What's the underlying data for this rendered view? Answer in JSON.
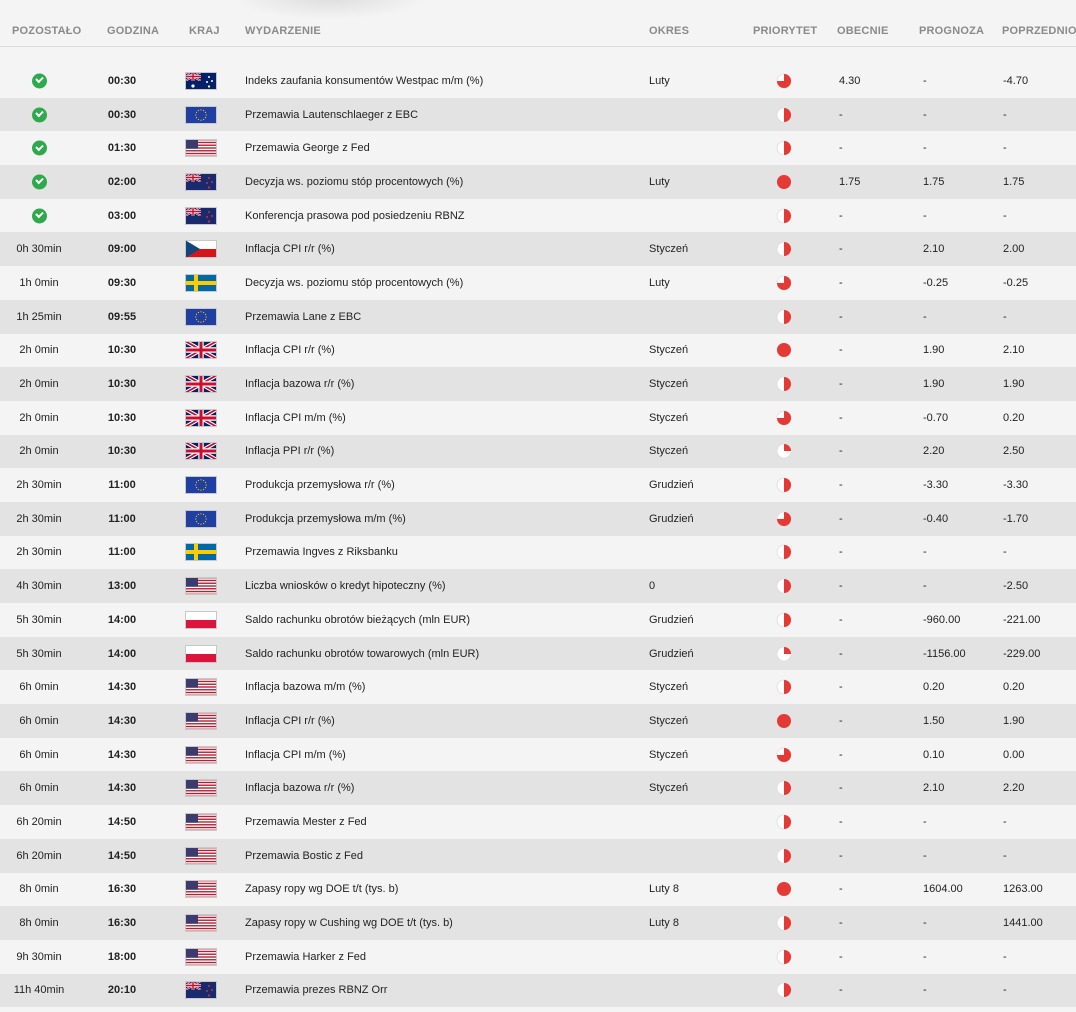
{
  "headers": {
    "remaining": "POZOSTAŁO",
    "time": "GODZINA",
    "country": "KRAJ",
    "event": "WYDARZENIE",
    "period": "OKRES",
    "priority": "PRIORYTET",
    "actual": "OBECNIE",
    "forecast": "PROGNOZA",
    "previous": "POPRZEDNIO"
  },
  "colors": {
    "check": "#2eaa4c",
    "priority": "#e53935"
  },
  "rows": [
    {
      "remaining": "",
      "done": true,
      "time": "00:30",
      "flag": "AU",
      "event": "Indeks zaufania konsumentów Westpac m/m (%)",
      "period": "Luty",
      "priority": 3,
      "actual": "4.30",
      "forecast": "-",
      "previous": "-4.70"
    },
    {
      "remaining": "",
      "done": true,
      "time": "00:30",
      "flag": "EU",
      "event": "Przemawia Lautenschlaeger z EBC",
      "period": "",
      "priority": 2,
      "actual": "-",
      "forecast": "-",
      "previous": "-"
    },
    {
      "remaining": "",
      "done": true,
      "time": "01:30",
      "flag": "US",
      "event": "Przemawia George z Fed",
      "period": "",
      "priority": 2,
      "actual": "-",
      "forecast": "-",
      "previous": "-"
    },
    {
      "remaining": "",
      "done": true,
      "time": "02:00",
      "flag": "NZ",
      "event": "Decyzja ws. poziomu stóp procentowych (%)",
      "period": "Luty",
      "priority": 4,
      "actual": "1.75",
      "forecast": "1.75",
      "previous": "1.75"
    },
    {
      "remaining": "",
      "done": true,
      "time": "03:00",
      "flag": "NZ",
      "event": "Konferencja prasowa pod posiedzeniu RBNZ",
      "period": "",
      "priority": 2,
      "actual": "-",
      "forecast": "-",
      "previous": "-"
    },
    {
      "remaining": "0h 30min",
      "done": false,
      "time": "09:00",
      "flag": "CZ",
      "event": "Inflacja CPI r/r (%)",
      "period": "Styczeń",
      "priority": 2,
      "actual": "-",
      "forecast": "2.10",
      "previous": "2.00"
    },
    {
      "remaining": "1h 0min",
      "done": false,
      "time": "09:30",
      "flag": "SE",
      "event": "Decyzja ws. poziomu stóp procentowych (%)",
      "period": "Luty",
      "priority": 3,
      "actual": "-",
      "forecast": "-0.25",
      "previous": "-0.25"
    },
    {
      "remaining": "1h 25min",
      "done": false,
      "time": "09:55",
      "flag": "EU",
      "event": "Przemawia Lane z EBC",
      "period": "",
      "priority": 2,
      "actual": "-",
      "forecast": "-",
      "previous": "-"
    },
    {
      "remaining": "2h 0min",
      "done": false,
      "time": "10:30",
      "flag": "GB",
      "event": "Inflacja CPI r/r (%)",
      "period": "Styczeń",
      "priority": 4,
      "actual": "-",
      "forecast": "1.90",
      "previous": "2.10"
    },
    {
      "remaining": "2h 0min",
      "done": false,
      "time": "10:30",
      "flag": "GB",
      "event": "Inflacja bazowa r/r (%)",
      "period": "Styczeń",
      "priority": 2,
      "actual": "-",
      "forecast": "1.90",
      "previous": "1.90"
    },
    {
      "remaining": "2h 0min",
      "done": false,
      "time": "10:30",
      "flag": "GB",
      "event": "Inflacja CPI m/m (%)",
      "period": "Styczeń",
      "priority": 3,
      "actual": "-",
      "forecast": "-0.70",
      "previous": "0.20"
    },
    {
      "remaining": "2h 0min",
      "done": false,
      "time": "10:30",
      "flag": "GB",
      "event": "Inflacja PPI r/r (%)",
      "period": "Styczeń",
      "priority": 1,
      "actual": "-",
      "forecast": "2.20",
      "previous": "2.50"
    },
    {
      "remaining": "2h 30min",
      "done": false,
      "time": "11:00",
      "flag": "EU",
      "event": "Produkcja przemysłowa r/r (%)",
      "period": "Grudzień",
      "priority": 2,
      "actual": "-",
      "forecast": "-3.30",
      "previous": "-3.30"
    },
    {
      "remaining": "2h 30min",
      "done": false,
      "time": "11:00",
      "flag": "EU",
      "event": "Produkcja przemysłowa m/m (%)",
      "period": "Grudzień",
      "priority": 3,
      "actual": "-",
      "forecast": "-0.40",
      "previous": "-1.70"
    },
    {
      "remaining": "2h 30min",
      "done": false,
      "time": "11:00",
      "flag": "SE",
      "event": "Przemawia Ingves z Riksbanku",
      "period": "",
      "priority": 2,
      "actual": "-",
      "forecast": "-",
      "previous": "-"
    },
    {
      "remaining": "4h 30min",
      "done": false,
      "time": "13:00",
      "flag": "US",
      "event": "Liczba wniosków o kredyt hipoteczny (%)",
      "period": "0",
      "priority": 2,
      "actual": "-",
      "forecast": "-",
      "previous": "-2.50"
    },
    {
      "remaining": "5h 30min",
      "done": false,
      "time": "14:00",
      "flag": "PL",
      "event": "Saldo rachunku obrotów bieżących (mln EUR)",
      "period": "Grudzień",
      "priority": 2,
      "actual": "-",
      "forecast": "-960.00",
      "previous": "-221.00"
    },
    {
      "remaining": "5h 30min",
      "done": false,
      "time": "14:00",
      "flag": "PL",
      "event": "Saldo rachunku obrotów towarowych (mln EUR)",
      "period": "Grudzień",
      "priority": 1,
      "actual": "-",
      "forecast": "-1156.00",
      "previous": "-229.00"
    },
    {
      "remaining": "6h 0min",
      "done": false,
      "time": "14:30",
      "flag": "US",
      "event": "Inflacja bazowa m/m (%)",
      "period": "Styczeń",
      "priority": 2,
      "actual": "-",
      "forecast": "0.20",
      "previous": "0.20"
    },
    {
      "remaining": "6h 0min",
      "done": false,
      "time": "14:30",
      "flag": "US",
      "event": "Inflacja CPI r/r (%)",
      "period": "Styczeń",
      "priority": 4,
      "actual": "-",
      "forecast": "1.50",
      "previous": "1.90"
    },
    {
      "remaining": "6h 0min",
      "done": false,
      "time": "14:30",
      "flag": "US",
      "event": "Inflacja CPI m/m (%)",
      "period": "Styczeń",
      "priority": 3,
      "actual": "-",
      "forecast": "0.10",
      "previous": "0.00"
    },
    {
      "remaining": "6h 0min",
      "done": false,
      "time": "14:30",
      "flag": "US",
      "event": "Inflacja bazowa r/r (%)",
      "period": "Styczeń",
      "priority": 2,
      "actual": "-",
      "forecast": "2.10",
      "previous": "2.20"
    },
    {
      "remaining": "6h 20min",
      "done": false,
      "time": "14:50",
      "flag": "US",
      "event": "Przemawia Mester z Fed",
      "period": "",
      "priority": 2,
      "actual": "-",
      "forecast": "-",
      "previous": "-"
    },
    {
      "remaining": "6h 20min",
      "done": false,
      "time": "14:50",
      "flag": "US",
      "event": "Przemawia Bostic z Fed",
      "period": "",
      "priority": 2,
      "actual": "-",
      "forecast": "-",
      "previous": "-"
    },
    {
      "remaining": "8h 0min",
      "done": false,
      "time": "16:30",
      "flag": "US",
      "event": "Zapasy ropy wg DOE t/t (tys. b)",
      "period": "Luty 8",
      "priority": 4,
      "actual": "-",
      "forecast": "1604.00",
      "previous": "1263.00"
    },
    {
      "remaining": "8h 0min",
      "done": false,
      "time": "16:30",
      "flag": "US",
      "event": "Zapasy ropy w Cushing wg DOE t/t (tys. b)",
      "period": "Luty 8",
      "priority": 2,
      "actual": "-",
      "forecast": "-",
      "previous": "1441.00"
    },
    {
      "remaining": "9h 30min",
      "done": false,
      "time": "18:00",
      "flag": "US",
      "event": "Przemawia Harker z Fed",
      "period": "",
      "priority": 2,
      "actual": "-",
      "forecast": "-",
      "previous": "-"
    },
    {
      "remaining": "11h 40min",
      "done": false,
      "time": "20:10",
      "flag": "NZ",
      "event": "Przemawia prezes RBNZ Orr",
      "period": "",
      "priority": 2,
      "actual": "-",
      "forecast": "-",
      "previous": "-"
    }
  ]
}
